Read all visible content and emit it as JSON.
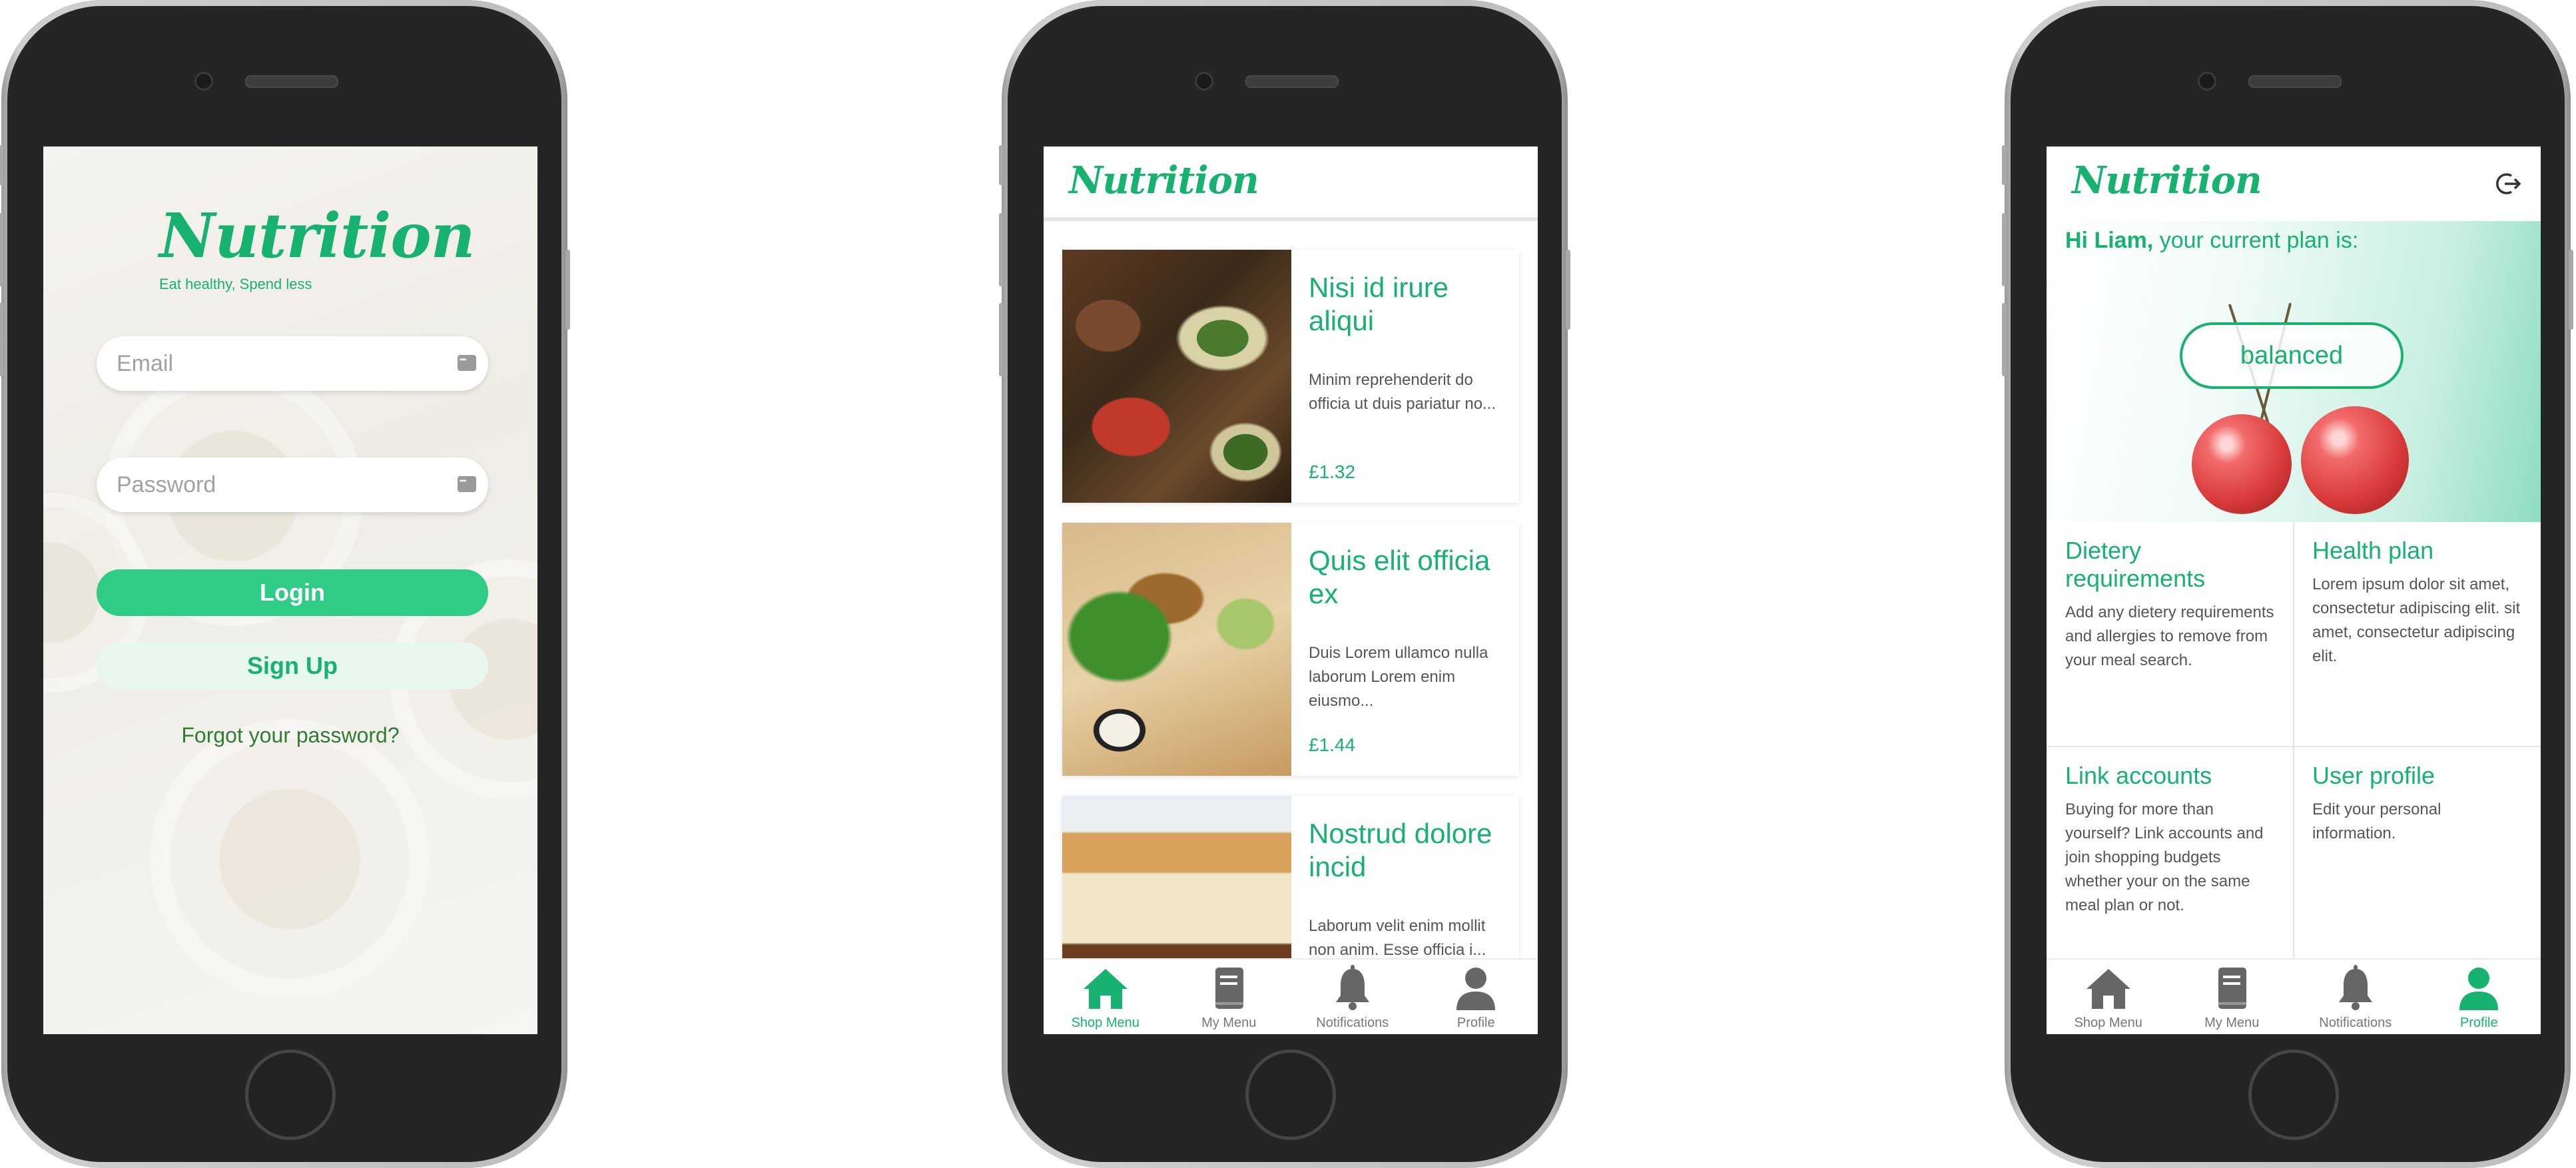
{
  "colors": {
    "accent": "#17b26f",
    "login_button": "#2fcc86",
    "signup_button_bg": "#e8f8ef",
    "phone_body": "#252525"
  },
  "login": {
    "logo": "Nutrition",
    "tagline": "Eat healthy, Spend less",
    "email_placeholder": "Email",
    "password_placeholder": "Password",
    "login_label": "Login",
    "signup_label": "Sign Up",
    "forgot_label": "Forgot your password?"
  },
  "shop": {
    "logo": "Nutrition",
    "items": [
      {
        "title": "Nisi id irure aliqui",
        "desc": "Minim reprehenderit do officia ut duis pariatur no...",
        "price": "£1.32"
      },
      {
        "title": "Quis elit officia ex",
        "desc": "Duis Lorem ullamco nulla laborum Lorem enim eiusmo...",
        "price": "£1.44"
      },
      {
        "title": "Nostrud dolore incid",
        "desc": "Laborum velit enim mollit non anim. Esse officia i...",
        "price": ""
      }
    ]
  },
  "tabs": [
    {
      "label": "Shop Menu",
      "icon": "home-icon"
    },
    {
      "label": "My Menu",
      "icon": "book-icon"
    },
    {
      "label": "Notifications",
      "icon": "bell-icon"
    },
    {
      "label": "Profile",
      "icon": "person-icon"
    }
  ],
  "profile": {
    "logo": "Nutrition",
    "greeting_name": "Hi Liam,",
    "greeting_rest": " your current plan is:",
    "plan": "balanced",
    "tiles": [
      {
        "title": "Dietery requirements",
        "body": "Add any dietery requirements and allergies to remove from your meal search."
      },
      {
        "title": "Health plan",
        "body": "Lorem ipsum dolor sit amet, consectetur adipiscing elit. sit amet, consectetur adipiscing elit."
      },
      {
        "title": "Link accounts",
        "body": "Buying for more than yourself? Link accounts and join shopping budgets whether your on the same meal plan or not."
      },
      {
        "title": "User profile",
        "body": "Edit your personal information."
      }
    ]
  }
}
